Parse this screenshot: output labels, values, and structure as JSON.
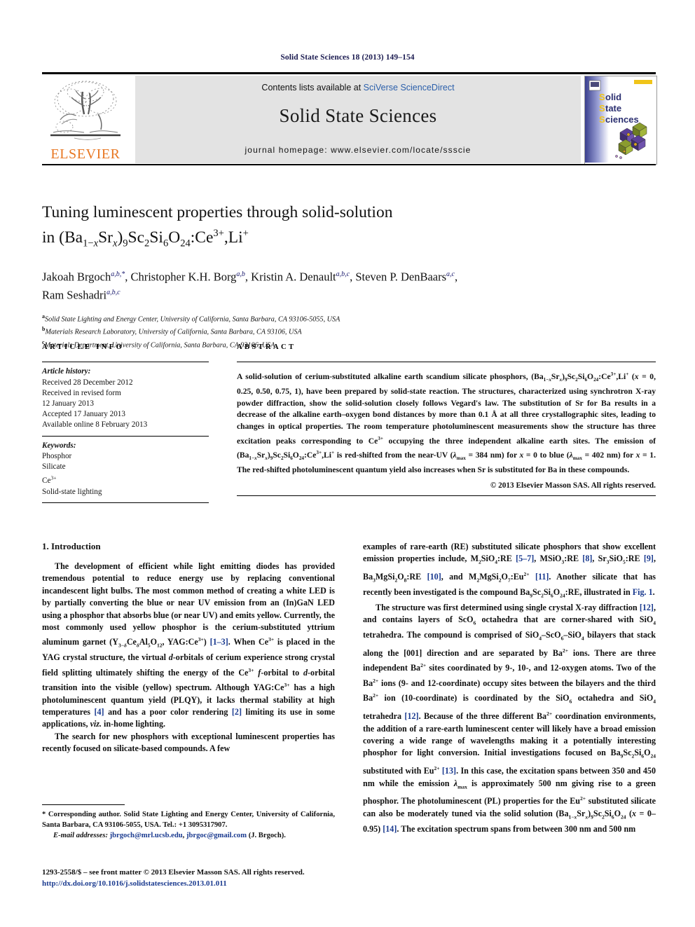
{
  "running_head": "Solid State Sciences 18 (2013) 149–154",
  "masthead": {
    "contents_prefix": "Contents lists available at ",
    "contents_link": "SciVerse ScienceDirect",
    "journal_title": "Solid State Sciences",
    "homepage": "journal homepage: www.elsevier.com/locate/ssscie",
    "publisher_name": "ELSEVIER",
    "cover_line1": "Solid",
    "cover_line2": "State",
    "cover_line3": "Sciences"
  },
  "article": {
    "title_line1": "Tuning luminescent properties through solid-solution",
    "title_line2_prefix": "in (Ba",
    "title_full": "Tuning luminescent properties through solid-solution in (Ba1−xSrx)9Sc2Si6O24:Ce3+,Li+",
    "authors": [
      {
        "name": "Jakoah Brgoch",
        "marks": "a,b,*"
      },
      {
        "name": "Christopher K.H. Borg",
        "marks": "a,b"
      },
      {
        "name": "Kristin A. Denault",
        "marks": "a,b,c"
      },
      {
        "name": "Steven P. DenBaars",
        "marks": "a,c"
      },
      {
        "name": "Ram Seshadri",
        "marks": "a,b,c"
      }
    ],
    "affiliations": [
      {
        "mark": "a",
        "text": "Solid State Lighting and Energy Center, University of California, Santa Barbara, CA 93106-5055, USA"
      },
      {
        "mark": "b",
        "text": "Materials Research Laboratory, University of California, Santa Barbara, CA 93106, USA"
      },
      {
        "mark": "c",
        "text": "Materials Department, University of California, Santa Barbara, CA 93106, USA"
      }
    ]
  },
  "info": {
    "heading": "ARTICLE INFO",
    "history_label": "Article history:",
    "history": [
      "Received 28 December 2012",
      "Received in revised form",
      "12 January 2013",
      "Accepted 17 January 2013",
      "Available online 8 February 2013"
    ],
    "keywords_label": "Keywords:",
    "keywords": [
      "Phosphor",
      "Silicate",
      "Ce3+",
      "Solid-state lighting"
    ]
  },
  "abstract": {
    "heading": "ABSTRACT",
    "copyright": "© 2013 Elsevier Masson SAS. All rights reserved.",
    "text": "A solid-solution of cerium-substituted alkaline earth scandium silicate phosphors, (Ba1−xSrx)9Sc2Si6O24:Ce3+,Li+ (x = 0, 0.25, 0.50, 0.75, 1), have been prepared by solid-state reaction. The structures, characterized using synchrotron X-ray powder diffraction, show the solid-solution closely follows Vegard's law. The substitution of Sr for Ba results in a decrease of the alkaline earth–oxygen bond distances by more than 0.1 Å at all three crystallographic sites, leading to changes in optical properties. The room temperature photoluminescent measurements show the structure has three excitation peaks corresponding to Ce3+ occupying the three independent alkaline earth sites. The emission of (Ba1−xSrx)9Sc2Si6O24:Ce3+,Li+ is red-shifted from the near-UV (λmax = 384 nm) for x = 0 to blue (λmax = 402 nm) for x = 1. The red-shifted photoluminescent quantum yield also increases when Sr is substituted for Ba in these compounds."
  },
  "body": {
    "section_number_title": "1. Introduction",
    "left_para_1": "The development of efficient while light emitting diodes has provided tremendous potential to reduce energy use by replacing conventional incandescent light bulbs. The most common method of creating a white LED is by partially converting the blue or near UV emission from an (In)GaN LED using a phosphor that absorbs blue (or near UV) and emits yellow. Currently, the most commonly used yellow phosphor is the cerium-substituted yttrium aluminum garnet (Y3−δCeδAl5O12, YAG:Ce3+) [1–3]. When Ce3+ is placed in the YAG crystal structure, the virtual d-orbitals of cerium experience strong crystal field splitting ultimately shifting the energy of the Ce3+ f-orbital to d-orbital transition into the visible (yellow) spectrum. Although YAG:Ce3+ has a high photoluminescent quantum yield (PLQY), it lacks thermal stability at high temperatures [4] and has a poor color rendering [2] limiting its use in some applications, viz. in-home lighting.",
    "left_para_2": "The search for new phosphors with exceptional luminescent properties has recently focused on silicate-based compounds. A few",
    "right_para_1": "examples of rare-earth (RE) substituted silicate phosphors that show excellent emission properties include, M2SiO4:RE [5–7], MSiO3:RE [8], Sr3SiO5:RE [9], Ba3MgSi2O8:RE [10], and M2MgSi2O7:Eu2+ [11]. Another silicate that has recently been investigated is the compound Ba9Sc2Si6O24:RE, illustrated in Fig. 1.",
    "right_para_2": "The structure was first determined using single crystal X-ray diffraction [12], and contains layers of ScO6 octahedra that are corner-shared with SiO4 tetrahedra. The compound is comprised of SiO4–ScO6–SiO4 bilayers that stack along the [001] direction and are separated by Ba2+ ions. There are three independent Ba2+ sites coordinated by 9-, 10-, and 12-oxygen atoms. Two of the Ba2+ ions (9- and 12-coordinate) occupy sites between the bilayers and the third Ba2+ ion (10-coordinate) is coordinated by the SiO6 octahedra and SiO4 tetrahedra [12]. Because of the three different Ba2+ coordination environments, the addition of a rare-earth luminescent center will likely have a broad emission covering a wide range of wavelengths making it a potentially interesting phosphor for light conversion. Initial investigations focused on Ba9Sc2Si6O24 substituted with Eu2+ [13]. In this case, the excitation spans between 350 and 450 nm while the emission λmax is approximately 500 nm giving rise to a green phosphor. The photoluminescent (PL) properties for the Eu2+ substituted silicate can also be moderately tuned via the solid solution (Ba1−xSrx)9Sc2Si6O24 (x = 0–0.95) [14]. The excitation spectrum spans from between 300 nm and 500 nm"
  },
  "footer": {
    "corresponding": "* Corresponding author. Solid State Lighting and Energy Center, University of California, Santa Barbara, CA 93106-5055, USA. Tel.: +1 3095317907.",
    "email_label": "E-mail addresses:",
    "email1": "jbrgoch@mrl.ucsb.edu",
    "email2": "jbrgoc@gmail.com",
    "email_suffix": "(J. Brgoch).",
    "issn_line": "1293-2558/$ – see front matter © 2013 Elsevier Masson SAS. All rights reserved.",
    "doi": "http://dx.doi.org/10.1016/j.solidstatesciences.2013.01.011"
  },
  "colors": {
    "link": "#2b5faa",
    "reference": "#1a3a8f",
    "elsevier_orange": "#e87722",
    "running_head": "#1a1a50",
    "band_bg": "#e3e3e3"
  }
}
